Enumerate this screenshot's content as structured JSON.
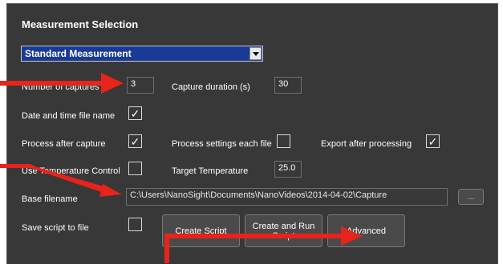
{
  "section": {
    "title": "Measurement Selection"
  },
  "measurement_select": {
    "value": "Standard Measurement"
  },
  "fields": {
    "number_of_captures_label": "Number of captures",
    "number_of_captures_value": "3",
    "capture_duration_label": "Capture duration (s)",
    "capture_duration_value": "30",
    "date_time_label": "Date and time file name",
    "date_time_checked": "✓",
    "process_after_capture_label": "Process after capture",
    "process_after_capture_checked": "✓",
    "process_settings_label": "Process settings each file",
    "process_settings_checked": "",
    "export_after_label": "Export after processing",
    "export_after_checked": "✓",
    "temperature_control_label": "Use Temperature Control",
    "temperature_control_checked": "",
    "target_temperature_label": "Target Temperature",
    "target_temperature_value": "25.0",
    "base_filename_label": "Base filename",
    "base_filename_value": "C:\\Users\\NanoSight\\Documents\\NanoVideos\\2014-04-02\\Capture",
    "browse_label": "...",
    "save_script_label": "Save script to file",
    "save_script_checked": ""
  },
  "buttons": {
    "create_script": "Create Script",
    "create_and_run": "Create and Run Script",
    "advanced": "Advanced"
  },
  "colors": {
    "panel_bg": "#383838",
    "select_bg": "#1a3a98",
    "annotation_arrow": "#e8231a"
  }
}
